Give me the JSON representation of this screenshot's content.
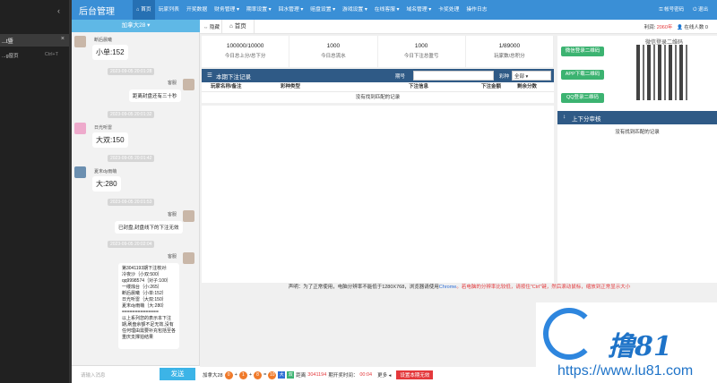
{
  "left": {
    "item_label": "...t暨",
    "item2_label": "...g窗页",
    "item2_key": "Ctrl+T"
  },
  "chat": {
    "header": "加拿大28 ▾",
    "input_placeholder": "请输入消息",
    "send": "发送",
    "messages": [
      {
        "name": "断后晨曦",
        "text": "小单:152",
        "time": "2023-09-05 20:01:28"
      },
      {
        "name": "客服",
        "text": "距离封盘还有三十秒",
        "time": "2023-09-05 20:01:32"
      },
      {
        "name": "日光听雷",
        "text": "大双:150",
        "time": "2023-09-05 20:01:42"
      },
      {
        "name": "夏末dy雨萌",
        "text": "大:280",
        "time": "2023-09-05 20:01:53"
      },
      {
        "name": "客服",
        "text": "已封盘,封盘线下的下注无效",
        "time": "2023-09-05 20:02:04"
      },
      {
        "name": "客服",
        "text": "第3041193期下注核对:\n冷夜沙｛小双:500｝\nqq9998574｛对子:100｝\n一缕烛台｛小:265｝\n断后晨曦｛小单:152｝\n日光听雷｛大双:150｝\n夏末dy雨萌｛大:280｝\n==============\n以上系列您的表示本下注期,刷盘余额不足无效,没有任何理由需要补充包括至各重庆支撑拍结果",
        "time": ""
      }
    ]
  },
  "nav": {
    "brand": "后台管理",
    "menus": [
      "首页",
      "玩家列表",
      "开奖数据",
      "财务管理 ▾",
      "期率设置 ▾",
      "回水管理 ▾",
      "赔盘设置 ▾",
      "游戏设置 ▾",
      "在线客服 ▾",
      "域名管理 ▾",
      "卡奖处理",
      "操作日志"
    ],
    "account": "帐号密码",
    "logout": "退出"
  },
  "tabs": {
    "home_icon": "隐藏",
    "home": "首页",
    "balance_label": "利润:",
    "balance": "2060年",
    "online": "在线人数 0"
  },
  "stats": [
    {
      "v": "100000/10000",
      "l": "今日总上分/总下分"
    },
    {
      "v": "1000",
      "l": "今日总流水"
    },
    {
      "v": "1000",
      "l": "今日下注总盈亏"
    },
    {
      "v": "1/89000",
      "l": "玩家数/总积分"
    }
  ],
  "bets": {
    "title": "本期下注记录",
    "period_label": "期号",
    "type_label": "彩种",
    "type_value": "全部",
    "columns": [
      "玩家名称/备注",
      "彩种类型",
      "下注信息",
      "下注金额",
      "剩余分数"
    ],
    "empty": "没有找到匹配的记录"
  },
  "right": {
    "btn1": "微信登录二维码",
    "btn2": "APP下载二维码",
    "btn3": "QQ登录二维码",
    "qr_title": "微信登录二维码",
    "panel_title": "上下分审核",
    "empty": "没有找到匹配的记录"
  },
  "notice": {
    "a": "声明：为了正常使用，电脑分辨率不能低于1280X768，浏览器请使用",
    "b": "Chrome",
    "c": "。若电脑的分辨率比较低，请按住\"Ctrl\"键，然后滚动鼠标，缩放到正常显示大小"
  },
  "bottom": {
    "game": "加拿大28",
    "balls": [
      "0",
      "1",
      "8",
      "10"
    ],
    "big": "大",
    "dbl": "双",
    "label": "距离",
    "period": "3041194",
    "next": "期开奖时间：",
    "time": "00:04",
    "more": "更多",
    "btn": "设置本期无效"
  },
  "logo": {
    "text": "撸81",
    "url": "https://www.lu81.com"
  }
}
